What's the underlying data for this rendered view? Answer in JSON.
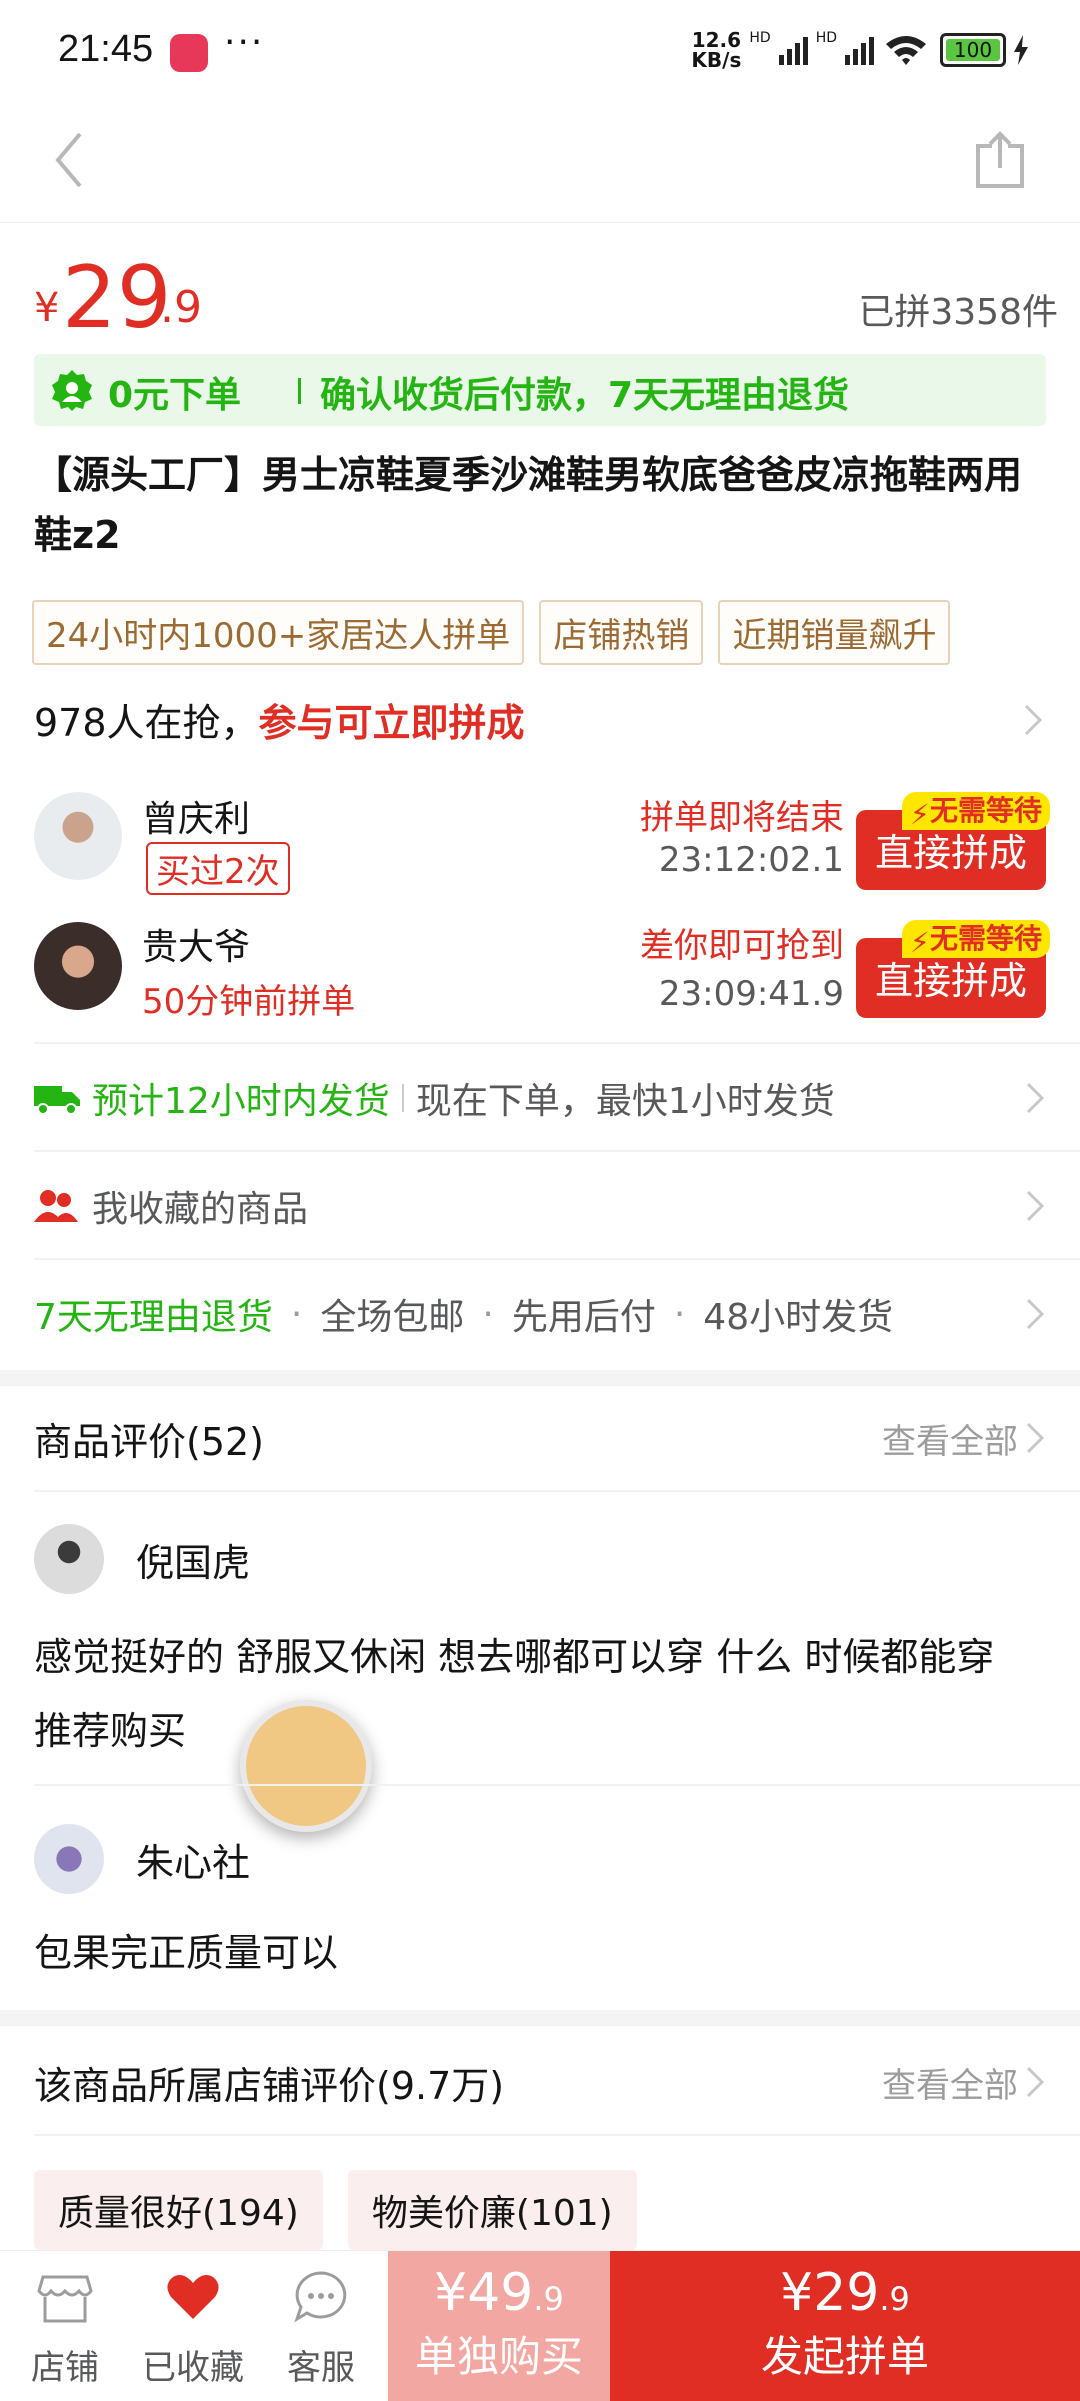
{
  "status_bar": {
    "time": "21:45",
    "net_speed_top": "12.6",
    "net_speed_bottom": "KB/s",
    "hd1": "HD",
    "hd2": "HD",
    "battery": "100",
    "dots": "···"
  },
  "product": {
    "price_symbol": "¥",
    "price_int": "29",
    "price_dec": ".9",
    "sold": "已拼3358件",
    "guarantee_1": "0元下单",
    "guarantee_2": "确认收货后付款，7天无理由退货",
    "title": "【源头工厂】男士凉鞋夏季沙滩鞋男软底爸爸皮凉拖鞋两用鞋z2",
    "tags": [
      "24小时内1000+家居达人拼单",
      "店铺热销",
      "近期销量飙升"
    ]
  },
  "group_buy": {
    "count_text": "978人在抢，",
    "count_cta": "参与可立即拼成",
    "groups": [
      {
        "name": "曾庆利",
        "sub": "买过2次",
        "status": "拼单即将结束",
        "timer": "23:12:02.1",
        "badge": "无需等待",
        "button": "直接拼成"
      },
      {
        "name": "贵大爷",
        "sub": "50分钟前拼单",
        "status": "差你即可抢到",
        "timer": "23:09:41.9",
        "badge": "无需等待",
        "button": "直接拼成"
      }
    ]
  },
  "shipping": {
    "primary": "预计12小时内发货",
    "secondary": "现在下单，最快1小时发货"
  },
  "favorites": {
    "label": "我收藏的商品"
  },
  "services": {
    "s1": "7天无理由退货",
    "s2": "全场包邮",
    "s3": "先用后付",
    "s4": "48小时发货",
    "dot": "·"
  },
  "reviews": {
    "header": "商品评价(52)",
    "view_all": "查看全部",
    "items": [
      {
        "user": "倪国虎",
        "text": "感觉挺好的 舒服又休闲 想去哪都可以穿 什么 时候都能穿  推荐购买"
      },
      {
        "user": "朱心社",
        "text": "包果完正质量可以"
      }
    ]
  },
  "shop_reviews": {
    "header": "该商品所属店铺评价(9.7万)",
    "view_all": "查看全部",
    "tags": [
      "质量很好(194)",
      "物美价廉(101)"
    ]
  },
  "bottom_bar": {
    "shop": "店铺",
    "favorited": "已收藏",
    "service": "客服",
    "solo_price_sym": "¥",
    "solo_price": "49",
    "solo_dec": ".9",
    "solo_label": "单独购买",
    "group_price_sym": "¥",
    "group_price": "29",
    "group_dec": ".9",
    "group_label": "发起拼单"
  },
  "colors": {
    "accent": "#e02e24",
    "green": "#25b513",
    "tag_border": "#e8d3b9"
  }
}
